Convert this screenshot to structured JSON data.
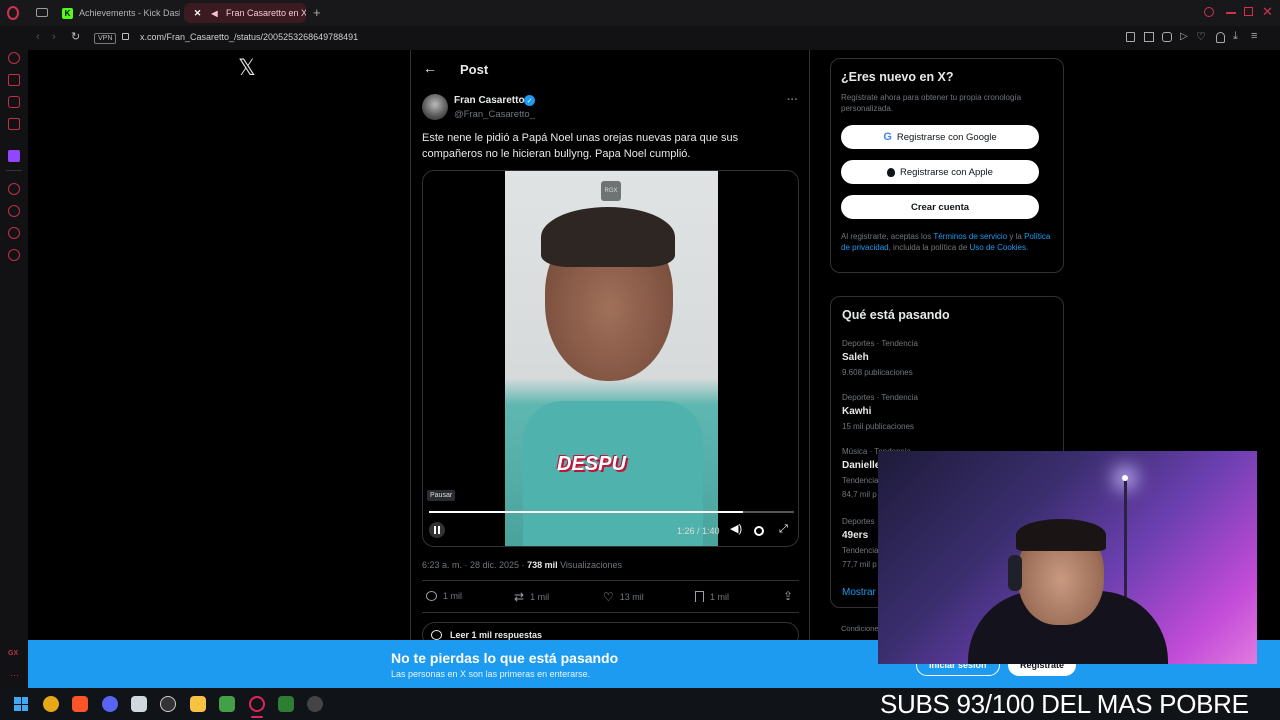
{
  "browser": {
    "tabs": [
      {
        "label": "Achievements - Kick Dash"
      },
      {
        "label": "Fran Casaretto en X: \""
      }
    ],
    "new_tab_symbol": "+",
    "vpn_badge": "VPN",
    "url": "x.com/Fran_Casaretto_/status/2005253268649788491"
  },
  "x_logo": "𝕏",
  "post": {
    "header_title": "Post",
    "author_name": "Fran Casaretto",
    "author_handle": "@Fran_Casaretto_",
    "more_symbol": "···",
    "text_line1": "Este nene le pidió a Papá Noel unas orejas nuevas para que sus",
    "text_line2": "compañeros no le hicieran bullyng. Papa Noel cumplió.",
    "video": {
      "watermark": "RGX",
      "overlay_text": "DESPU",
      "pause_tooltip": "Pausar",
      "time": "1:26 / 1:40",
      "progress": 0.86
    },
    "meta_time": "6:23 a. m. · 28 dic. 2025 · ",
    "views_count": "738 mil",
    "views_label": " Visualizaciones",
    "replies": "1 mil",
    "reposts": "1 mil",
    "likes": "13 mil",
    "bookmarks": "1 mil",
    "read_replies": "Leer 1 mil respuestas"
  },
  "signup": {
    "title": "¿Eres nuevo en X?",
    "subtitle": "Regístrate ahora para obtener tu propia cronología personalizada.",
    "google_button": "Registrarse con Google",
    "apple_button": "Registrarse con Apple",
    "create_button": "Crear cuenta",
    "legal_1": "Al registrarte, aceptas los ",
    "legal_terms": "Términos de servicio",
    "legal_2": " y la ",
    "legal_privacy": "Política de privacidad",
    "legal_3": ", incluida la política de ",
    "legal_cookies": "Uso de Cookies",
    "legal_4": "."
  },
  "trends": {
    "title": "Qué está pasando",
    "items": [
      {
        "context": "Deportes · Tendencia",
        "name": "Saleh",
        "count": "9.608 publicaciones"
      },
      {
        "context": "Deportes · Tendencia",
        "name": "Kawhi",
        "count": "15 mil publicaciones"
      },
      {
        "context": "Música · Tendencia",
        "name": "Danielle",
        "count": "Tendencia",
        "extra": "84,7 mil p"
      },
      {
        "context": "Deportes",
        "name": "49ers",
        "count": "Tendencia",
        "extra": "77,7 mil p"
      }
    ],
    "show_more": "Mostrar",
    "footer_partial": "Condicione"
  },
  "banner": {
    "title": "No te pierdas lo que está pasando",
    "subtitle": "Las personas en X son las primeras en enterarse.",
    "login": "Iniciar sesión",
    "register": "Regístrate"
  },
  "stream_overlay": {
    "text": "SUBS 93/100 DEL MAS POBRE"
  },
  "colors": {
    "accent": "#1d9bf0",
    "opera_red": "#c0304b",
    "taskbar": "#101418"
  }
}
